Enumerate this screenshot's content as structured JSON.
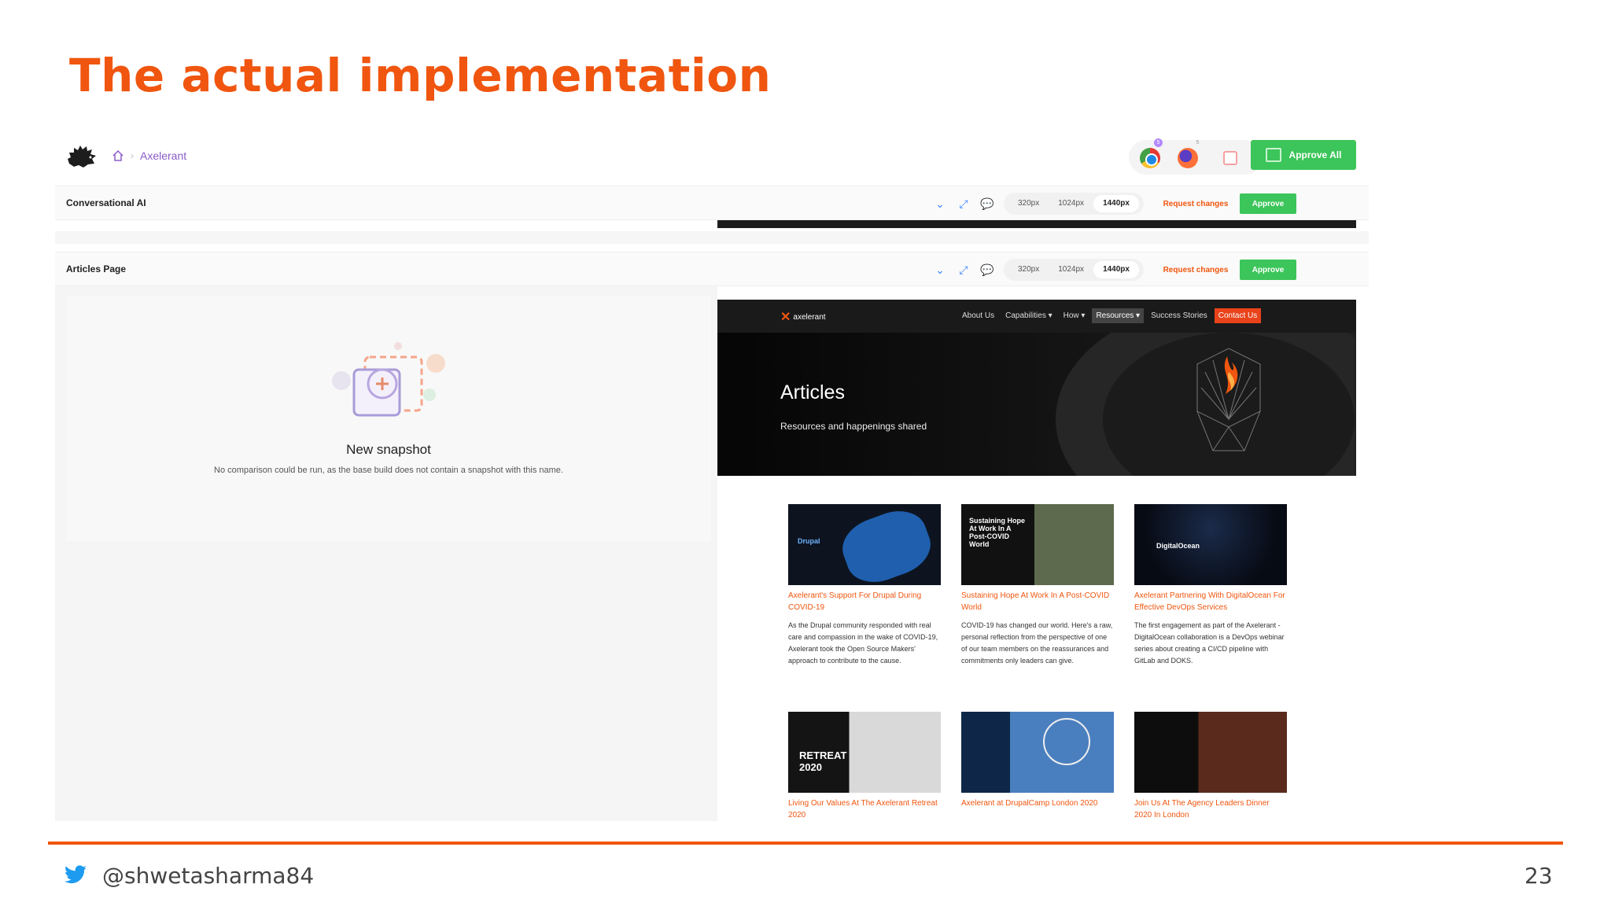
{
  "slide": {
    "title": "The actual implementation",
    "footer_handle": "@shwetasharma84",
    "page_number": "23"
  },
  "app": {
    "breadcrumb": "Axelerant",
    "approve_all_label": "Approve All",
    "browser_badges": [
      "5",
      "5"
    ],
    "accent_color": "#3cc55a",
    "brand_color": "#f0560f"
  },
  "snapshots": [
    {
      "name": "Conversational AI",
      "sizes": [
        "320px",
        "1024px",
        "1440px"
      ],
      "active_size": "1440px",
      "request_label": "Request changes",
      "approve_label": "Approve"
    },
    {
      "name": "Articles Page",
      "sizes": [
        "320px",
        "1024px",
        "1440px"
      ],
      "active_size": "1440px",
      "request_label": "Request changes",
      "approve_label": "Approve"
    }
  ],
  "empty_state": {
    "title": "New snapshot",
    "message": "No comparison could be run, as the base build does not contain a snapshot with this name."
  },
  "site": {
    "logo": "axelerant",
    "nav": [
      "About Us",
      "Capabilities ▾",
      "How ▾",
      "Resources ▾",
      "Success Stories",
      "Contact Us"
    ],
    "hero_title": "Articles",
    "hero_subtitle": "Resources and happenings shared",
    "articles": [
      {
        "title": "Axelerant's Support For Drupal During COVID-19",
        "desc": "As the Drupal community responded with real care and compassion in the wake of COVID-19, Axelerant took the Open Source Makers' approach to contribute to the cause.",
        "img_text": "Drupal"
      },
      {
        "title": "Sustaining Hope At Work In A Post-COVID World",
        "desc": "COVID-19 has changed our world. Here's a raw, personal reflection from the perspective of one of our team members on the reassurances and commitments only leaders can give.",
        "img_text": "Sustaining Hope At Work In A Post-COVID World"
      },
      {
        "title": "Axelerant Partnering With DigitalOcean For Effective DevOps Services",
        "desc": "The first engagement as part of the Axelerant - DigitalOcean collaboration is a DevOps webinar series about creating a CI/CD pipeline with GitLab and DOKS.",
        "img_text": "DigitalOcean"
      },
      {
        "title": "Living Our Values At The Axelerant Retreat 2020",
        "desc": "",
        "img_text": "RETREAT 2020"
      },
      {
        "title": "Axelerant at DrupalCamp London 2020",
        "desc": "",
        "img_text": ""
      },
      {
        "title": "Join Us At The Agency Leaders Dinner 2020 In London",
        "desc": "",
        "img_text": ""
      }
    ]
  }
}
